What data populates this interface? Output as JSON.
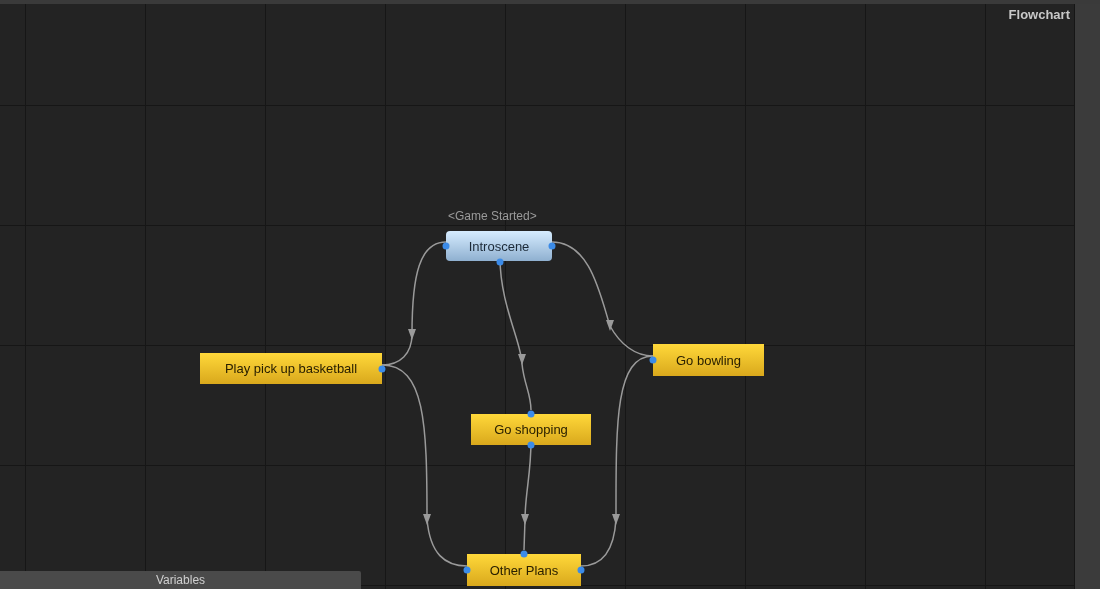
{
  "panel_title": "Flowchart",
  "nodes": [
    {
      "kind": "start",
      "event": "<Game Started>",
      "label": "Introscene"
    },
    {
      "kind": "block",
      "label": "Play pick up basketball"
    },
    {
      "kind": "block",
      "label": "Go bowling"
    },
    {
      "kind": "block",
      "label": "Go shopping"
    },
    {
      "kind": "block",
      "label": "Other Plans"
    }
  ],
  "variables_tab": "Variables"
}
